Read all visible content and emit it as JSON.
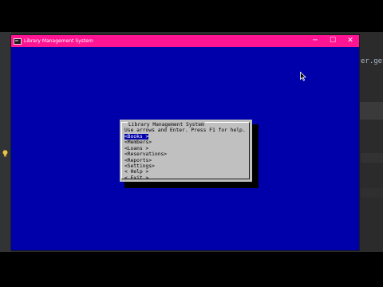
{
  "ide": {
    "code_snippet": "er.get"
  },
  "window": {
    "title": "Library Management System",
    "minimize": "─",
    "maximize": "☐",
    "close": "✕"
  },
  "dialog": {
    "title": "Library Management System",
    "help_text": "Use arrows and Enter. Press F1 for help.",
    "menu_items": [
      {
        "label": "<Books >",
        "selected": true
      },
      {
        "label": "<Members>",
        "selected": false
      },
      {
        "label": "<Loans >",
        "selected": false
      },
      {
        "label": "<Reservations>",
        "selected": false
      },
      {
        "label": "<Reports>",
        "selected": false
      },
      {
        "label": "<Settings>",
        "selected": false
      },
      {
        "label": "< Help >",
        "selected": false
      },
      {
        "label": "< Exit >",
        "selected": false
      }
    ]
  },
  "colors": {
    "titlebar": "#ff1493",
    "console_bg": "#0000aa",
    "dialog_bg": "#c0c0c0",
    "selection": "#0000aa"
  }
}
